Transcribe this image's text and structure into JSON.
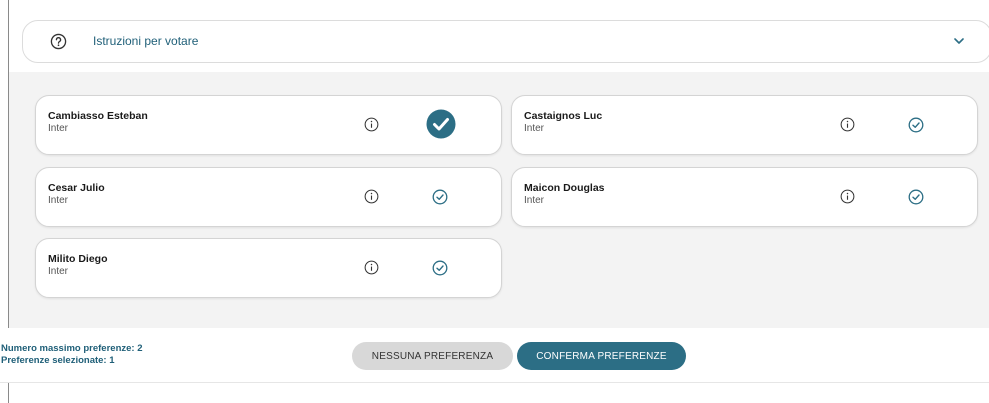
{
  "instructions": {
    "title": "Istruzioni per votare",
    "icon": "help-circle-icon",
    "toggle_icon": "chevron-down-icon"
  },
  "candidates": [
    {
      "name": "Cambiasso Esteban",
      "team": "Inter",
      "selected": true
    },
    {
      "name": "Castaignos Luc",
      "team": "Inter",
      "selected": false
    },
    {
      "name": "Cesar Julio",
      "team": "Inter",
      "selected": false
    },
    {
      "name": "Maicon Douglas",
      "team": "Inter",
      "selected": false
    },
    {
      "name": "Milito Diego",
      "team": "Inter",
      "selected": false
    }
  ],
  "footer": {
    "max_preferences": "Numero massimo preferenze: 2",
    "selected_preferences": "Preferenze selezionate: 1",
    "no_preference_label": "NESSUNA PREFERENZA",
    "confirm_label": "CONFERMA PREFERENZE"
  },
  "colors": {
    "accent": "#2c6e85",
    "accent_text": "#1f5f78",
    "panel_bg": "#f3f3f3",
    "secondary_button": "#d8d8d8"
  }
}
